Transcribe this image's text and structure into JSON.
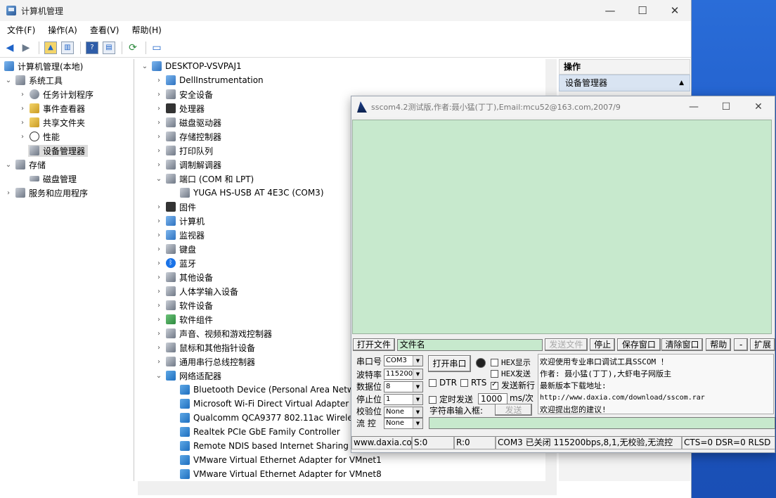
{
  "cm": {
    "title": "计算机管理",
    "menu": [
      "文件(F)",
      "操作(A)",
      "查看(V)",
      "帮助(H)"
    ],
    "left_tree": [
      {
        "label": "计算机管理(本地)",
        "depth": 0,
        "exp": ""
      },
      {
        "label": "系统工具",
        "depth": 1,
        "exp": "⌄"
      },
      {
        "label": "任务计划程序",
        "depth": 2,
        "exp": "›"
      },
      {
        "label": "事件查看器",
        "depth": 2,
        "exp": "›"
      },
      {
        "label": "共享文件夹",
        "depth": 2,
        "exp": "›"
      },
      {
        "label": "性能",
        "depth": 2,
        "exp": "›"
      },
      {
        "label": "设备管理器",
        "depth": 2,
        "exp": ""
      },
      {
        "label": "存储",
        "depth": 1,
        "exp": "⌄"
      },
      {
        "label": "磁盘管理",
        "depth": 2,
        "exp": ""
      },
      {
        "label": "服务和应用程序",
        "depth": 1,
        "exp": "›"
      }
    ],
    "device_root": "DESKTOP-VSVPAJ1",
    "devices": [
      {
        "label": "DellInstrumentation",
        "depth": 1,
        "exp": "›"
      },
      {
        "label": "安全设备",
        "depth": 1,
        "exp": "›"
      },
      {
        "label": "处理器",
        "depth": 1,
        "exp": "›"
      },
      {
        "label": "磁盘驱动器",
        "depth": 1,
        "exp": "›"
      },
      {
        "label": "存储控制器",
        "depth": 1,
        "exp": "›"
      },
      {
        "label": "打印队列",
        "depth": 1,
        "exp": "›"
      },
      {
        "label": "调制解调器",
        "depth": 1,
        "exp": "›"
      },
      {
        "label": "端口 (COM 和 LPT)",
        "depth": 1,
        "exp": "⌄"
      },
      {
        "label": "YUGA HS-USB AT 4E3C (COM3)",
        "depth": 2,
        "exp": ""
      },
      {
        "label": "固件",
        "depth": 1,
        "exp": "›"
      },
      {
        "label": "计算机",
        "depth": 1,
        "exp": "›"
      },
      {
        "label": "监视器",
        "depth": 1,
        "exp": "›"
      },
      {
        "label": "键盘",
        "depth": 1,
        "exp": "›"
      },
      {
        "label": "蓝牙",
        "depth": 1,
        "exp": "›"
      },
      {
        "label": "其他设备",
        "depth": 1,
        "exp": "›"
      },
      {
        "label": "人体学输入设备",
        "depth": 1,
        "exp": "›"
      },
      {
        "label": "软件设备",
        "depth": 1,
        "exp": "›"
      },
      {
        "label": "软件组件",
        "depth": 1,
        "exp": "›"
      },
      {
        "label": "声音、视频和游戏控制器",
        "depth": 1,
        "exp": "›"
      },
      {
        "label": "鼠标和其他指针设备",
        "depth": 1,
        "exp": "›"
      },
      {
        "label": "通用串行总线控制器",
        "depth": 1,
        "exp": "›"
      },
      {
        "label": "网络适配器",
        "depth": 1,
        "exp": "⌄"
      },
      {
        "label": "Bluetooth Device (Personal Area Netwo",
        "depth": 2,
        "exp": ""
      },
      {
        "label": "Microsoft Wi-Fi Direct Virtual Adapter",
        "depth": 2,
        "exp": ""
      },
      {
        "label": "Qualcomm QCA9377 802.11ac Wireles",
        "depth": 2,
        "exp": ""
      },
      {
        "label": "Realtek PCIe GbE Family Controller",
        "depth": 2,
        "exp": ""
      },
      {
        "label": "Remote NDIS based Internet Sharing D",
        "depth": 2,
        "exp": ""
      },
      {
        "label": "VMware Virtual Ethernet Adapter for VMnet1",
        "depth": 2,
        "exp": ""
      },
      {
        "label": "VMware Virtual Ethernet Adapter for VMnet8",
        "depth": 2,
        "exp": ""
      }
    ],
    "ops_header": "操作",
    "ops_section": "设备管理器"
  },
  "ss": {
    "title": "sscom4.2测试版,作者:聂小猛(丁丁),Email:mcu52@163.com,2007/9",
    "open_file": "打开文件",
    "filename": "文件名",
    "send_file": "发送文件",
    "stop": "停止",
    "save_window": "保存窗口",
    "clear_window": "清除窗口",
    "help": "帮助",
    "minus": "-",
    "expand": "扩展",
    "port_label": "串口号",
    "port_value": "COM3",
    "baud_label": "波特率",
    "baud_value": "115200",
    "data_label": "数据位",
    "data_value": "8",
    "stop_label": "停止位",
    "stop_value": "1",
    "parity_label": "校验位",
    "parity_value": "None",
    "flow_label": "流 控",
    "flow_value": "None",
    "open_port": "打开串口",
    "hex_show": "HEX显示",
    "hex_send": "HEX发送",
    "dtr": "DTR",
    "rts": "RTS",
    "send_newline": "发送新行",
    "timed_send": "定时发送",
    "interval": "1000",
    "interval_unit": "ms/次",
    "str_input": "字符串输入框:",
    "send": "发送",
    "info": [
      "欢迎使用专业串口调试工具SSCOM ！",
      "作者: 聂小猛(丁丁),大虾电子网版主",
      "最新版本下载地址:",
      "http://www.daxia.com/download/sscom.rar",
      "欢迎提出您的建议!"
    ],
    "status": {
      "site": "www.daxia.cor",
      "s": "S:0",
      "r": "R:0",
      "port_state": "COM3 已关闭  115200bps,8,1,无校验,无流控",
      "lines": "CTS=0 DSR=0 RLSD"
    }
  }
}
